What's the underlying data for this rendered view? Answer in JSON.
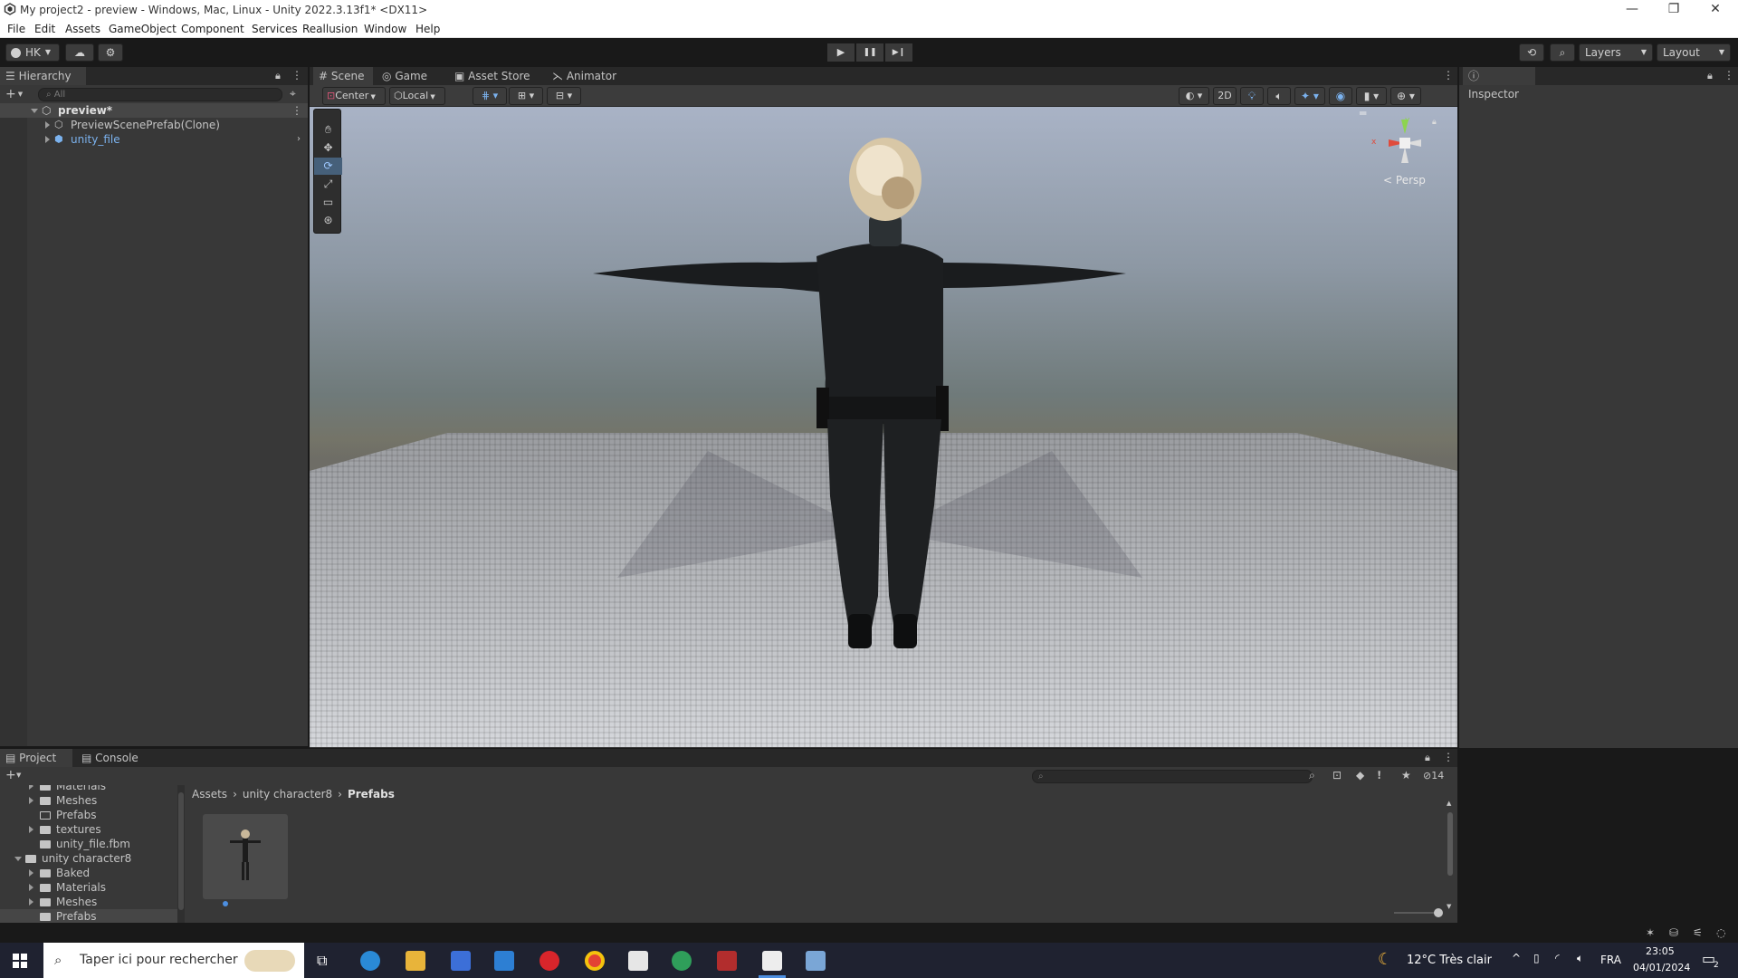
{
  "window": {
    "title": "My project2 - preview - Windows, Mac, Linux - Unity 2022.3.13f1* <DX11>",
    "min": "—",
    "max": "❐",
    "close": "✕"
  },
  "menu": [
    "File",
    "Edit",
    "Assets",
    "GameObject",
    "Component",
    "Services",
    "Reallusion",
    "Window",
    "Help"
  ],
  "toolbar": {
    "account": "HK",
    "play": "▶",
    "pause": "❚❚",
    "step": "▶❙",
    "layers": "Layers",
    "layout": "Layout"
  },
  "hierarchy": {
    "tab": "Hierarchy",
    "search_placeholder": "All",
    "scene_name": "preview*",
    "items": [
      "PreviewScenePrefab(Clone)",
      "unity_file"
    ]
  },
  "scene": {
    "tabs": [
      "Scene",
      "Game",
      "Asset Store",
      "Animator"
    ],
    "pivot": "Center",
    "space": "Local",
    "mode_2d": "2D",
    "persp": "Persp",
    "gizmo_x": "x",
    "gizmo_y": "y"
  },
  "inspector": {
    "tab": "Inspector"
  },
  "project": {
    "tabs": [
      "Project",
      "Console"
    ],
    "tree": [
      {
        "label": "Materials",
        "indent": 2,
        "arrow": true
      },
      {
        "label": "Meshes",
        "indent": 2,
        "arrow": true
      },
      {
        "label": "Prefabs",
        "indent": 2,
        "arrow": false,
        "open": true
      },
      {
        "label": "textures",
        "indent": 2,
        "arrow": true
      },
      {
        "label": "unity_file.fbm",
        "indent": 2,
        "arrow": false
      },
      {
        "label": "unity character8",
        "indent": 1,
        "arrow": true,
        "expanded": true
      },
      {
        "label": "Baked",
        "indent": 2,
        "arrow": true
      },
      {
        "label": "Materials",
        "indent": 2,
        "arrow": true
      },
      {
        "label": "Meshes",
        "indent": 2,
        "arrow": true
      },
      {
        "label": "Prefabs",
        "indent": 2,
        "arrow": false,
        "selected": true
      }
    ],
    "breadcrumb": [
      "Assets",
      "unity character8",
      "Prefabs"
    ],
    "hidden_count": "14"
  },
  "taskbar": {
    "search_placeholder": "Taper ici pour rechercher",
    "weather": "12°C  Très clair",
    "lang": "FRA",
    "time": "23:05",
    "date": "04/01/2024",
    "notif_count": "2"
  },
  "colors": {
    "accent": "#4d8fe0",
    "selection": "#2c5d87",
    "prefab_blue": "#7bb2ee"
  }
}
